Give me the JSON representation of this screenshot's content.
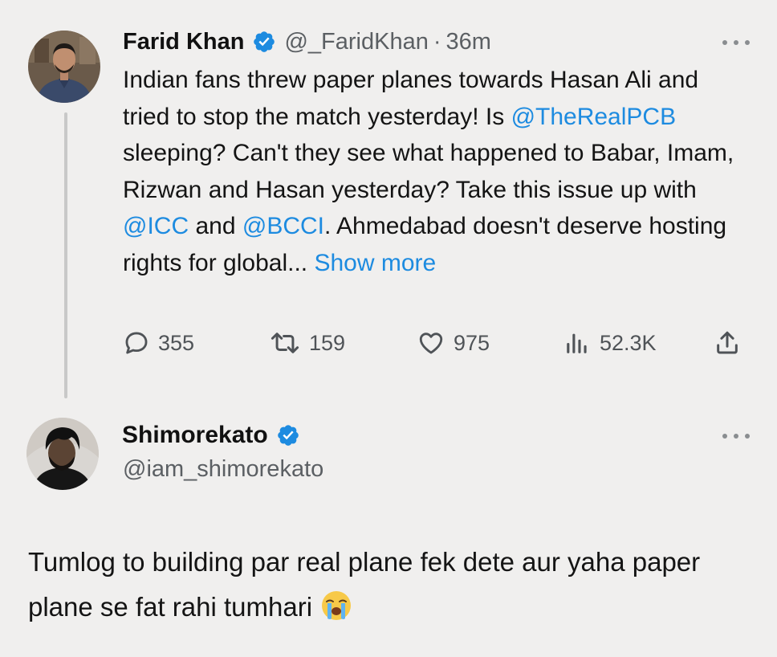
{
  "tweet": {
    "author_name": "Farid Khan",
    "handle": "@_FaridKhan",
    "separator": "·",
    "time": "36m",
    "text_parts": [
      "Indian fans threw paper planes towards Hasan Ali and tried to stop the match yesterday! Is ",
      "@TheRealPCB",
      " sleeping? Can't they see what happened to Babar, Imam, Rizwan and Hasan yesterday? Take this issue up with ",
      "@ICC",
      " and ",
      "@BCCI",
      ". Ahmedabad doesn't deserve hosting rights for global... ",
      "Show more"
    ],
    "stats": {
      "replies": "355",
      "retweets": "159",
      "likes": "975",
      "views": "52.3K"
    }
  },
  "reply": {
    "author_name": "Shimorekato",
    "handle": "@iam_shimorekato",
    "text": "Tumlog to building par real plane fek dete aur yaha paper plane se fat rahi tumhari"
  },
  "icons": {
    "verified": "verified-badge-icon",
    "more": "more-dots-icon",
    "reply": "reply-bubble-icon",
    "retweet": "retweet-icon",
    "like": "heart-icon",
    "views": "views-bars-icon",
    "share": "share-upload-icon",
    "emoji": "loudly-crying-face-emoji"
  },
  "colors": {
    "background": "#f0efee",
    "link": "#1d8be0",
    "verified": "#1d8be0",
    "secondary_text": "#5b5f63"
  }
}
